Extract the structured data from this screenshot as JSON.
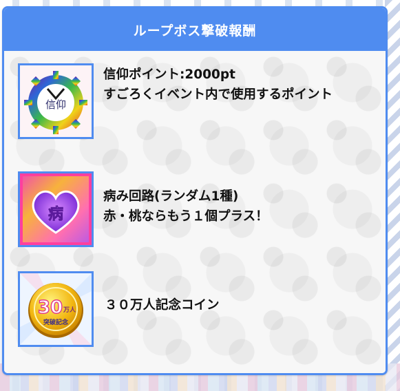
{
  "panel": {
    "title": "ループボス撃破報酬"
  },
  "rewards": [
    {
      "icon": "faith-points-badge-icon",
      "name": "信仰ポイント:2000pt",
      "description": "すごろくイベント内で使用するポイント",
      "badge_text": "信仰"
    },
    {
      "icon": "sick-circuit-heart-icon",
      "name": "病み回路(ランダム1種)",
      "description": "赤・桃ならもう１個プラス！",
      "badge_text": "病"
    },
    {
      "icon": "300k-commemorative-coin-icon",
      "name": "",
      "description": "３０万人記念コイン",
      "badge_number": "30",
      "badge_unit": "万人",
      "badge_caption": "突破記念"
    }
  ],
  "colors": {
    "accent": "#4f8cf0",
    "header_text": "#ffffff",
    "body_text": "#111111"
  }
}
